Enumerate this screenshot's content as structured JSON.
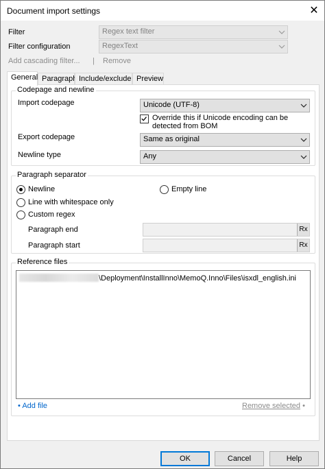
{
  "window": {
    "title": "Document import settings"
  },
  "filter": {
    "label": "Filter",
    "value": "Regex text filter",
    "config_label": "Filter configuration",
    "config_value": "RegexText",
    "add_cascading": "Add cascading filter...",
    "separator": "|",
    "remove": "Remove"
  },
  "tabs": [
    "General",
    "Paragraph",
    "Include/exclude",
    "Preview"
  ],
  "codepage": {
    "group_title": "Codepage and newline",
    "import_label": "Import codepage",
    "import_value": "Unicode (UTF-8)",
    "override_label": "Override this if Unicode encoding can be detected from BOM",
    "override_checked": true,
    "export_label": "Export codepage",
    "export_value": "Same as original",
    "newline_label": "Newline type",
    "newline_value": "Any"
  },
  "paragraph": {
    "group_title": "Paragraph separator",
    "options": {
      "newline": "Newline",
      "empty_line": "Empty line",
      "whitespace": "Line with whitespace only",
      "custom": "Custom regex"
    },
    "selected": "newline",
    "end_label": "Paragraph end",
    "start_label": "Paragraph start",
    "rx_label": "Rx"
  },
  "reference": {
    "group_title": "Reference files",
    "file_path": "\\Deployment\\InstallInno\\MemoQ.Inno\\Files\\isxdl_english.ini",
    "add_bullet": "•",
    "add_file": "Add file",
    "remove_selected": "Remove selected",
    "remove_bullet": "•"
  },
  "buttons": {
    "ok": "OK",
    "cancel": "Cancel",
    "help": "Help"
  },
  "colors": {
    "accent": "#0078d7",
    "link": "#0066cc"
  },
  "icons": {
    "close": "close-icon",
    "dropdown": "chevron-down-icon",
    "check": "checkmark-icon"
  }
}
